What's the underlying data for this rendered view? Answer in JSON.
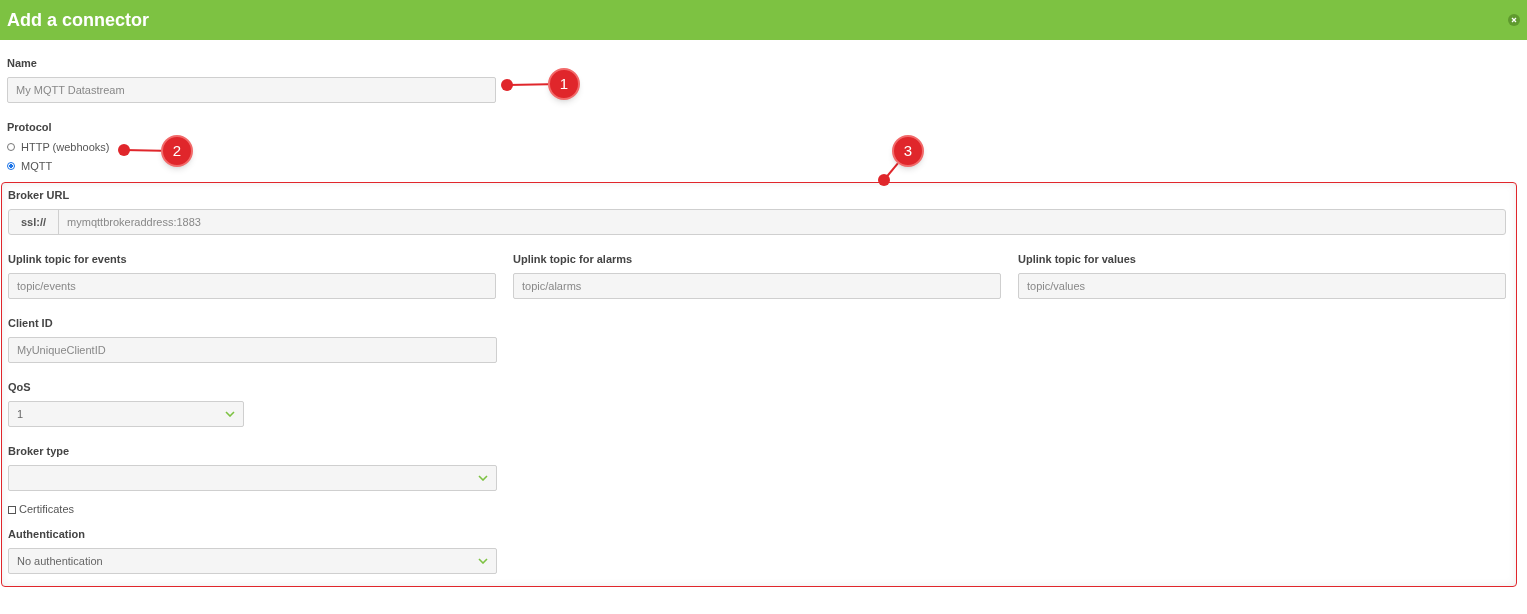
{
  "window": {
    "title": "Add a connector"
  },
  "name_field": {
    "label": "Name",
    "placeholder": "My MQTT Datastream"
  },
  "protocol": {
    "label": "Protocol",
    "options": [
      {
        "label": "HTTP (webhooks)",
        "selected": false
      },
      {
        "label": "MQTT",
        "selected": true
      }
    ]
  },
  "mqtt": {
    "broker_url": {
      "label": "Broker URL",
      "prefix": "ssl://",
      "placeholder": "mymqttbrokeraddress:1883"
    },
    "topics": [
      {
        "label": "Uplink topic for events",
        "placeholder": "topic/events"
      },
      {
        "label": "Uplink topic for alarms",
        "placeholder": "topic/alarms"
      },
      {
        "label": "Uplink topic for values",
        "placeholder": "topic/values"
      }
    ],
    "client_id": {
      "label": "Client ID",
      "placeholder": "MyUniqueClientID"
    },
    "qos": {
      "label": "QoS",
      "value": "1"
    },
    "broker_type": {
      "label": "Broker type"
    },
    "certificates": {
      "label": "Certificates",
      "checked": false
    },
    "authentication": {
      "label": "Authentication",
      "value": "No authentication"
    }
  },
  "annotations": [
    {
      "label": "1"
    },
    {
      "label": "2"
    },
    {
      "label": "3"
    }
  ]
}
